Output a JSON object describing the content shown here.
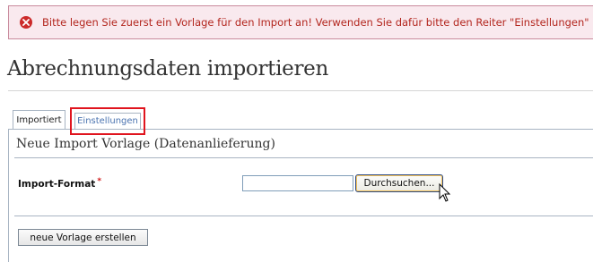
{
  "error": {
    "message": "Bitte legen Sie zuerst ein Vorlage für den Import an! Verwenden Sie dafür bitte den Reiter \"Einstellungen\"",
    "icon": "error-x-icon"
  },
  "page": {
    "title": "Abrechnungsdaten importieren"
  },
  "tabs": [
    {
      "label": "Importiert",
      "active": true
    },
    {
      "label": "Einstellungen",
      "active": false,
      "highlighted": true
    }
  ],
  "form": {
    "title": "Neue Import Vorlage (Datenanlieferung)",
    "import_format_label": "Import-Format",
    "required_marker": "*",
    "file_value": "",
    "browse_label": "Durchsuchen...",
    "create_label": "neue Vorlage erstellen"
  },
  "colors": {
    "error_text": "#b3261e",
    "error_bg": "#f9e9ee",
    "highlight": "#e0141e",
    "link_blue": "#4a73b0"
  }
}
